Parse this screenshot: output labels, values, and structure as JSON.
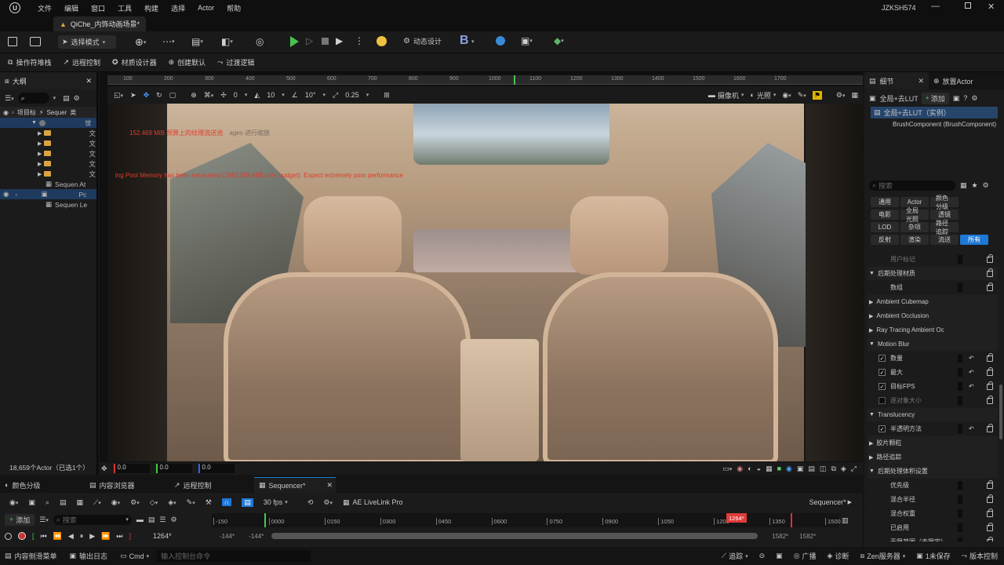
{
  "menu": {
    "items": [
      "文件",
      "编辑",
      "窗口",
      "工具",
      "构建",
      "选择",
      "Actor",
      "帮助"
    ],
    "user": "JZKSH574"
  },
  "tab": {
    "level_name": "QiChe_内饰动画场景*"
  },
  "toolbar": {
    "select_mode": "选择模式",
    "dynamic_design": "动态设计"
  },
  "subtoolbar": {
    "items": [
      "操作符堆栈",
      "远程控制",
      "材质设计器",
      "创建默认",
      "过渡逻辑"
    ]
  },
  "outliner": {
    "title": "大纲",
    "col_item": "项目标",
    "col_seq": "Sequer",
    "col_type": "类",
    "rows": [
      {
        "label": "世"
      },
      {
        "label": "文"
      },
      {
        "label": "文"
      },
      {
        "label": "文"
      },
      {
        "label": "文"
      },
      {
        "label": "文"
      },
      {
        "label": "Sequen At"
      },
      {
        "label": "Pc"
      },
      {
        "label": "Sequen Le"
      }
    ],
    "footer": "18,659个Actor（已选1个）"
  },
  "viewport": {
    "ruler": [
      "100",
      "200",
      "300",
      "400",
      "500",
      "600",
      "700",
      "800",
      "900",
      "1000",
      "1100",
      "1200",
      "1300",
      "1400",
      "1500",
      "1600",
      "1700"
    ],
    "snap_rot": "10°",
    "snap_move": "10",
    "snap_angle": "10°",
    "snap_scale": "0.25",
    "zero": "0",
    "camera": "摄像机",
    "lit": "光照",
    "warn1": "152.469 MiB 预算上的纹理流送池",
    "warn1b": "ages 进行缩放",
    "warn2": "ing Pool Memory has been exhausted (2462.595 MiB over budget). Expect extremely poor performance",
    "coords": [
      "0.0",
      "0.0",
      "0.0"
    ]
  },
  "bottom_tabs": {
    "items": [
      "颜色分级",
      "内容浏览器",
      "远程控制",
      "Sequencer*"
    ]
  },
  "sequencer": {
    "add": "添加",
    "search_placeholder": "搜索",
    "fps": "30 fps",
    "livelink": "AE LiveLink Pro",
    "title": "Sequencer*",
    "ticks": [
      "-150",
      "0000",
      "0150",
      "0300",
      "0450",
      "0600",
      "0750",
      "0900",
      "1050",
      "1200",
      "1350",
      "1500"
    ],
    "playhead": "1264*",
    "current": "1264*",
    "start_a": "-144*",
    "start_b": "-144*",
    "end_a": "1582*",
    "end_b": "1582*"
  },
  "details": {
    "title": "细节",
    "place": "放置Actor",
    "actor_name": "全局+去LUT",
    "add": "添加",
    "instance": "全局+去LUT（实例）",
    "component": "BrushComponent (BrushComponent)",
    "search_placeholder": "搜索",
    "filters": [
      "通用",
      "Actor",
      "颜色分级",
      "电影",
      "全局光照",
      "透镜",
      "LOD",
      "杂项",
      "路径追踪",
      "反射",
      "渲染",
      "流送",
      "所有"
    ],
    "props": [
      {
        "label": "用户标记",
        "indent": 1,
        "check": "none",
        "dim": true
      },
      {
        "label": "后期处理材质",
        "indent": 0,
        "check": "none",
        "section": true
      },
      {
        "label": "数组",
        "indent": 1,
        "check": "none"
      },
      {
        "label": "Ambient Cubemap",
        "indent": 0,
        "check": "none",
        "section": true,
        "collapsed": true
      },
      {
        "label": "Ambient Occlusion",
        "indent": 0,
        "check": "none",
        "section": true,
        "collapsed": true
      },
      {
        "label": "Ray Tracing Ambient Oc",
        "indent": 0,
        "check": "none",
        "section": true,
        "collapsed": true
      },
      {
        "label": "Motion Blur",
        "indent": 0,
        "check": "none",
        "section": true
      },
      {
        "label": "数量",
        "indent": 1,
        "check": "on"
      },
      {
        "label": "最大",
        "indent": 1,
        "check": "on"
      },
      {
        "label": "目标FPS",
        "indent": 1,
        "check": "on"
      },
      {
        "label": "逐对象大小",
        "indent": 1,
        "check": "off",
        "dim": true
      },
      {
        "label": "Translucency",
        "indent": 0,
        "check": "none",
        "section": true
      },
      {
        "label": "半透明方法",
        "indent": 1,
        "check": "on"
      },
      {
        "label": "胶片颗粒",
        "indent": 0,
        "check": "none",
        "section": true,
        "collapsed": true
      },
      {
        "label": "路径追踪",
        "indent": 0,
        "check": "none",
        "section": true,
        "collapsed": true
      },
      {
        "label": "后期处理体积设置",
        "indent": 0,
        "check": "none",
        "section": true
      },
      {
        "label": "优先级",
        "indent": 1,
        "check": "none"
      },
      {
        "label": "混合半径",
        "indent": 1,
        "check": "none"
      },
      {
        "label": "混合权重",
        "indent": 1,
        "check": "none"
      },
      {
        "label": "已启用",
        "indent": 1,
        "check": "none"
      },
      {
        "label": "无限范围（未限定）",
        "indent": 1,
        "check": "none"
      }
    ]
  },
  "statusbar": {
    "content_drawer": "内容侧滑菜单",
    "output_log": "输出日志",
    "cmd": "Cmd",
    "cmd_placeholder": "输入控制台命令",
    "trace": "追踪",
    "broadcast": "广播",
    "diag": "诊断",
    "zen": "Zen服务器",
    "unsaved": "1未保存",
    "version": "版本控制"
  },
  "colors": {
    "accent": "#1e78d6",
    "playhead": "#e03b3b",
    "warning": "#e23b2b",
    "folder": "#d9a441"
  }
}
